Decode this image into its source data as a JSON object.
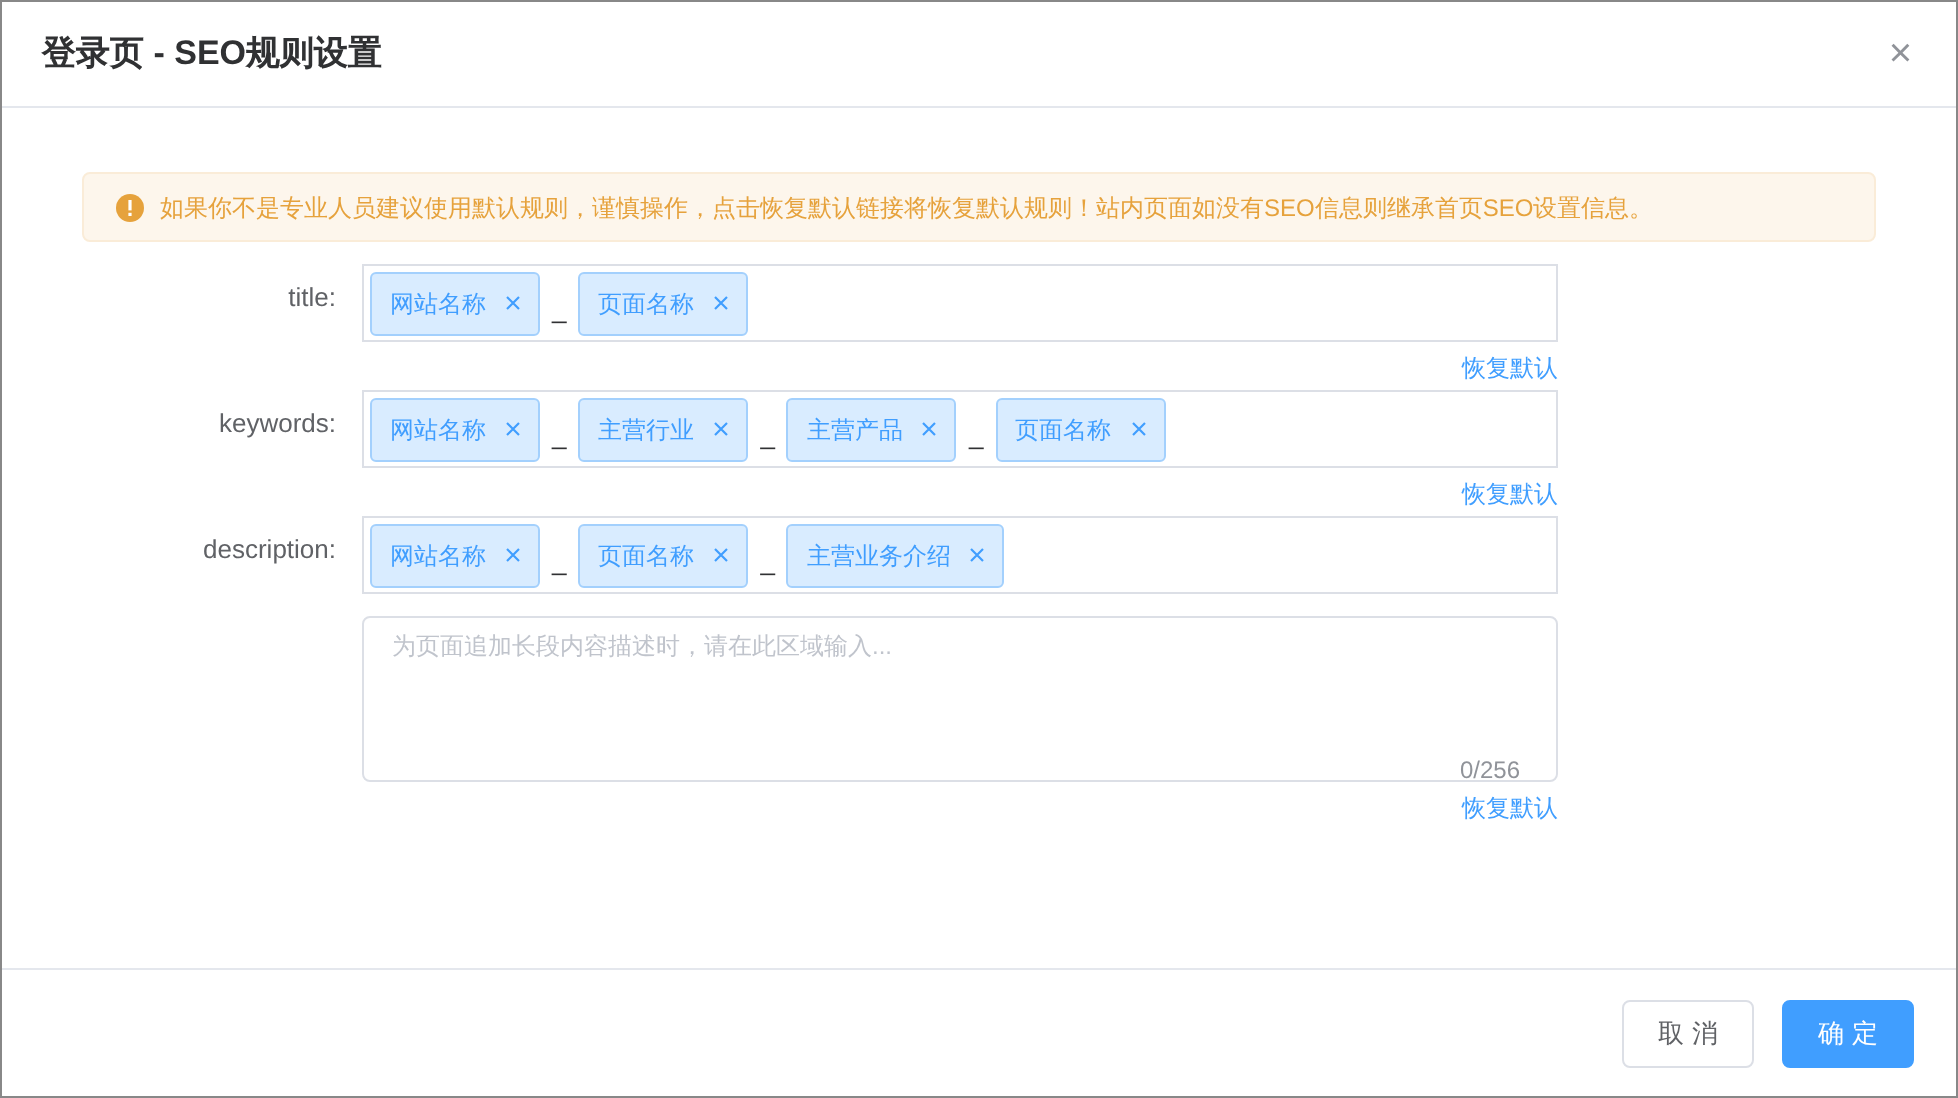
{
  "dialog": {
    "title": "登录页 - SEO规则设置",
    "close": "×"
  },
  "alert": {
    "text": "如果你不是专业人员建议使用默认规则，谨慎操作，点击恢复默认链接将恢复默认规则！站内页面如没有SEO信息则继承首页SEO设置信息。"
  },
  "fields": [
    {
      "label": "title:",
      "tags": [
        {
          "label": "网站名称"
        },
        {
          "separator": "_",
          "label": "页面名称"
        }
      ],
      "restore": "恢复默认"
    },
    {
      "label": "keywords:",
      "tags": [
        {
          "label": "网站名称"
        },
        {
          "separator": "_",
          "label": "主营行业"
        },
        {
          "separator": "_",
          "label": "主营产品"
        },
        {
          "separator": "_",
          "label": "页面名称"
        }
      ],
      "restore": "恢复默认"
    },
    {
      "label": "description:",
      "tags": [
        {
          "label": "网站名称"
        },
        {
          "separator": "_",
          "label": "页面名称"
        },
        {
          "separator": "_",
          "label": "主营业务介绍"
        }
      ],
      "textarea": {
        "placeholder": "为页面追加长段内容描述时，请在此区域输入...",
        "counter": "0/256"
      },
      "restore": "恢复默认"
    }
  ],
  "buttons": [
    {
      "label": "取 消",
      "kind": "secondary"
    },
    {
      "label": "确 定",
      "kind": "primary"
    }
  ]
}
